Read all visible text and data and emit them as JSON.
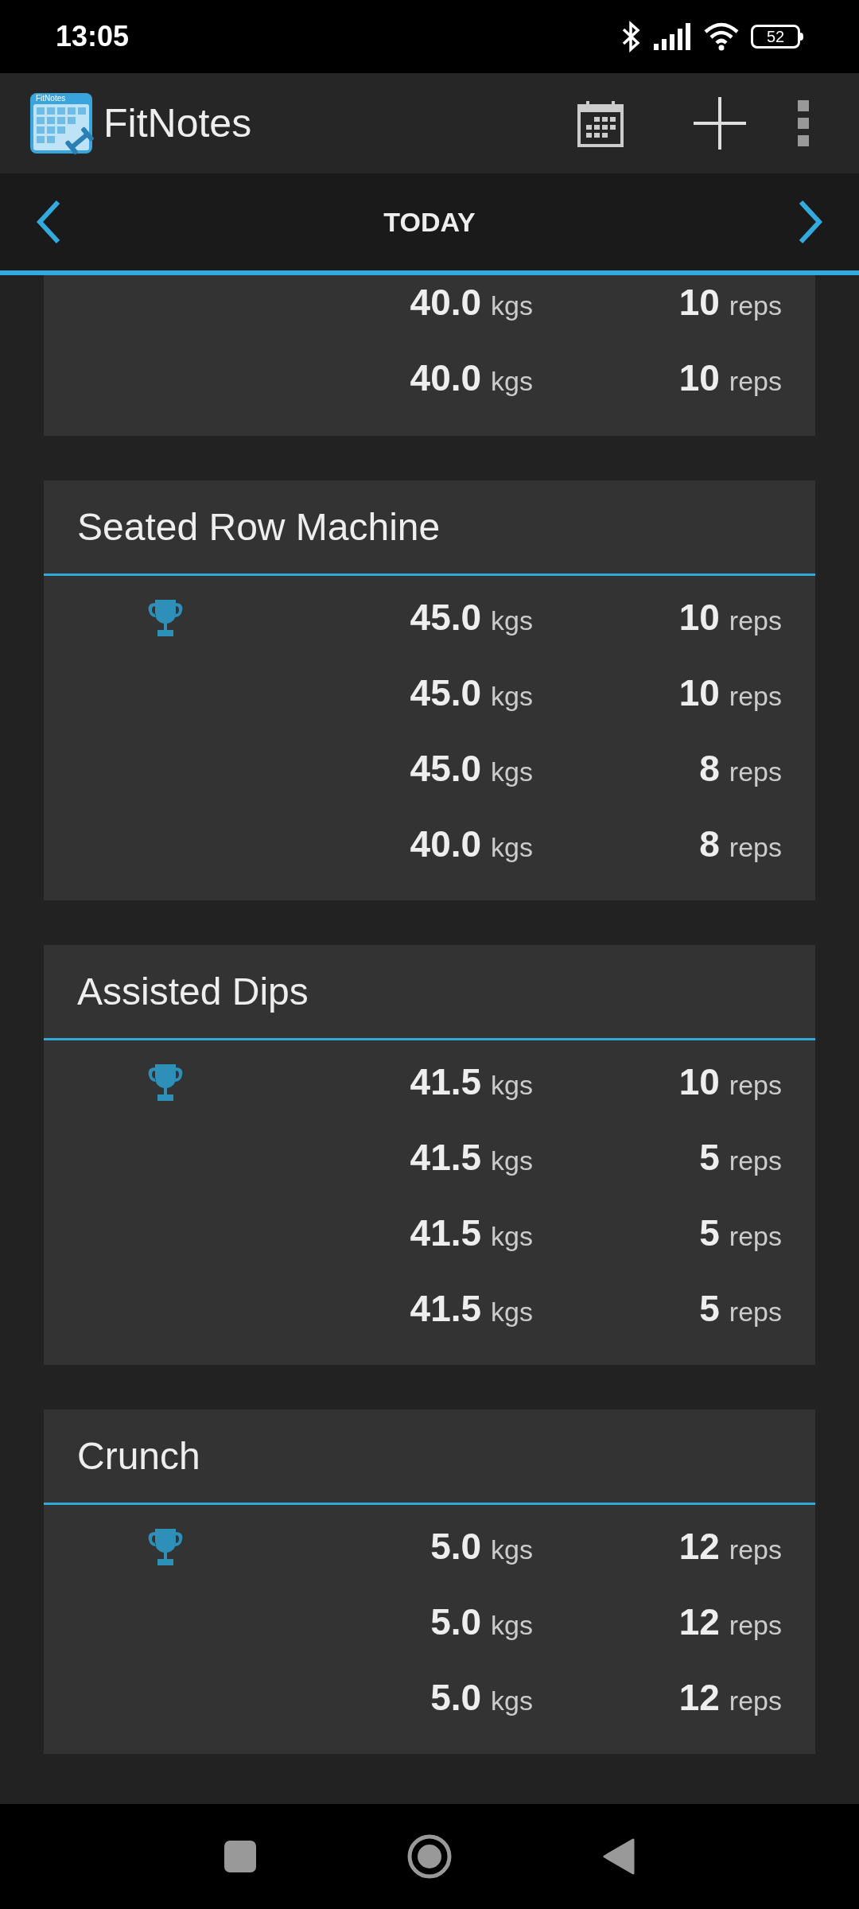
{
  "status_bar": {
    "time": "13:05",
    "battery": "52"
  },
  "app_bar": {
    "logo_text": "FitNotes",
    "title": "FitNotes"
  },
  "date_bar": {
    "label": "TODAY"
  },
  "exercises": [
    {
      "sets": [
        {
          "record": false,
          "weight": "40.0",
          "weight_unit": "kgs",
          "reps": "10",
          "reps_unit": "reps"
        },
        {
          "record": false,
          "weight": "40.0",
          "weight_unit": "kgs",
          "reps": "10",
          "reps_unit": "reps"
        }
      ]
    },
    {
      "name": "Seated Row Machine",
      "sets": [
        {
          "record": true,
          "weight": "45.0",
          "weight_unit": "kgs",
          "reps": "10",
          "reps_unit": "reps"
        },
        {
          "record": false,
          "weight": "45.0",
          "weight_unit": "kgs",
          "reps": "10",
          "reps_unit": "reps"
        },
        {
          "record": false,
          "weight": "45.0",
          "weight_unit": "kgs",
          "reps": "8",
          "reps_unit": "reps"
        },
        {
          "record": false,
          "weight": "40.0",
          "weight_unit": "kgs",
          "reps": "8",
          "reps_unit": "reps"
        }
      ]
    },
    {
      "name": "Assisted Dips",
      "sets": [
        {
          "record": true,
          "weight": "41.5",
          "weight_unit": "kgs",
          "reps": "10",
          "reps_unit": "reps"
        },
        {
          "record": false,
          "weight": "41.5",
          "weight_unit": "kgs",
          "reps": "5",
          "reps_unit": "reps"
        },
        {
          "record": false,
          "weight": "41.5",
          "weight_unit": "kgs",
          "reps": "5",
          "reps_unit": "reps"
        },
        {
          "record": false,
          "weight": "41.5",
          "weight_unit": "kgs",
          "reps": "5",
          "reps_unit": "reps"
        }
      ]
    },
    {
      "name": "Crunch",
      "sets": [
        {
          "record": true,
          "weight": "5.0",
          "weight_unit": "kgs",
          "reps": "12",
          "reps_unit": "reps"
        },
        {
          "record": false,
          "weight": "5.0",
          "weight_unit": "kgs",
          "reps": "12",
          "reps_unit": "reps"
        },
        {
          "record": false,
          "weight": "5.0",
          "weight_unit": "kgs",
          "reps": "12",
          "reps_unit": "reps"
        }
      ]
    }
  ]
}
